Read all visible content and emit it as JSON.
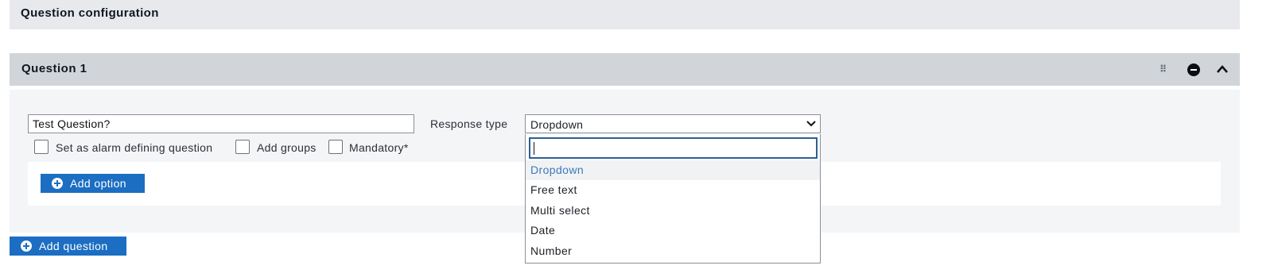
{
  "section": {
    "title": "Question configuration"
  },
  "question": {
    "title": "Question 1",
    "text_value": "Test Question?",
    "response_type_label": "Response type",
    "response_type_value": "Dropdown",
    "checkboxes": [
      {
        "label": "Set as alarm defining question",
        "checked": false
      },
      {
        "label": "Add groups",
        "checked": false
      },
      {
        "label": "Mandatory*",
        "checked": false
      }
    ],
    "add_option_label": "Add option"
  },
  "dropdown": {
    "search_value": "",
    "options": [
      "Dropdown",
      "Free text",
      "Multi select",
      "Date",
      "Number"
    ],
    "selected": "Dropdown"
  },
  "add_question_label": "Add question",
  "colors": {
    "primary": "#1b6ec2",
    "header_bg": "#d1d5da",
    "section_bg": "#e8e9ec",
    "selected_option_text": "#3b79b8"
  }
}
